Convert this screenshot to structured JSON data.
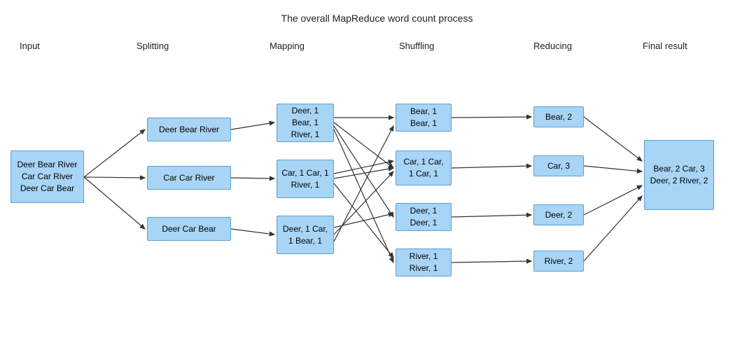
{
  "title": "The overall MapReduce word count process",
  "stages": {
    "input": "Input",
    "splitting": "Splitting",
    "mapping": "Mapping",
    "shuffling": "Shuffling",
    "reducing": "Reducing",
    "final": "Final result"
  },
  "boxes": {
    "input": "Deer Bear River\nCar Car River\nDeer Car Bear",
    "split1": "Deer Bear River",
    "split2": "Car Car River",
    "split3": "Deer Car Bear",
    "map1": "Deer, 1\nBear, 1\nRiver, 1",
    "map2": "Car, 1\nCar, 1\nRiver, 1",
    "map3": "Deer, 1\nCar, 1\nBear, 1",
    "shuf1": "Bear, 1\nBear, 1",
    "shuf2": "Car, 1\nCar, 1\nCar, 1",
    "shuf3": "Deer, 1\nDeer, 1",
    "shuf4": "River, 1\nRiver, 1",
    "red1": "Bear, 2",
    "red2": "Car, 3",
    "red3": "Deer, 2",
    "red4": "River, 2",
    "final": "Bear, 2\nCar, 3\nDeer, 2\nRiver, 2"
  }
}
